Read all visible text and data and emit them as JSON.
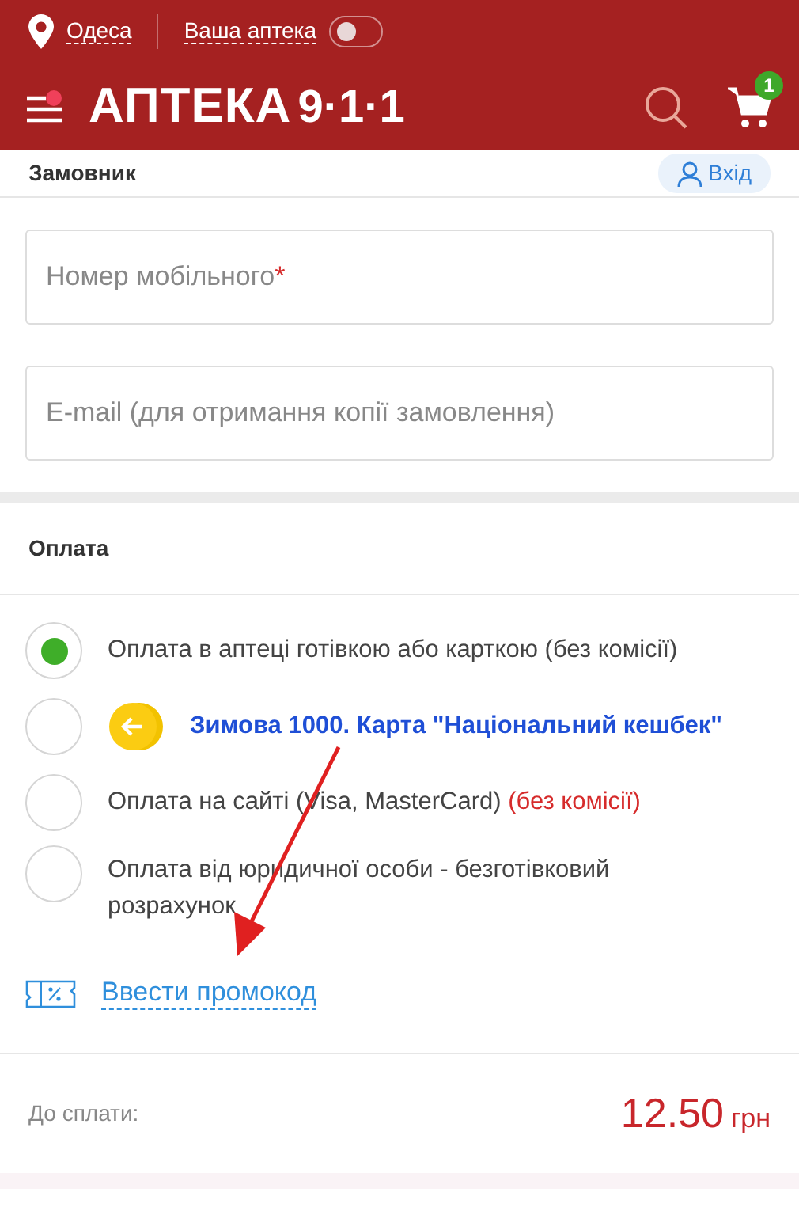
{
  "header": {
    "city": "Одеса",
    "pharmacy_label": "Ваша аптека",
    "pharmacy_toggle": {
      "on": false
    },
    "logo": "АПТЕКА",
    "logo_digits": "9·1·1",
    "menu_notification": true,
    "cart_count": "1"
  },
  "customer": {
    "title": "Замовник",
    "login": "Вхід",
    "fields": [
      {
        "placeholder": "Номер мобільного",
        "required_mark": "*"
      },
      {
        "placeholder": "E-mail (для отримання копії замовлення)"
      }
    ]
  },
  "payment": {
    "title": "Оплата",
    "options": [
      {
        "kind": "plain",
        "label": "Оплата в аптеці готівкою або карткою (без комісії)",
        "selected": true
      },
      {
        "kind": "promo",
        "label": "Зимова 1000. Карта \"Національний кешбек\"",
        "selected": false
      },
      {
        "kind": "note",
        "label": "Оплата на сайті (Visa, MasterCard)",
        "note": "(без комісії)",
        "selected": false
      },
      {
        "kind": "plain",
        "label": "Оплата від юридичної особи - безготівковий розрахунок",
        "selected": false
      }
    ],
    "promo_link": "Ввести промокод"
  },
  "total": {
    "label": "До сплати:",
    "amount": "12.50",
    "currency": "грн"
  }
}
